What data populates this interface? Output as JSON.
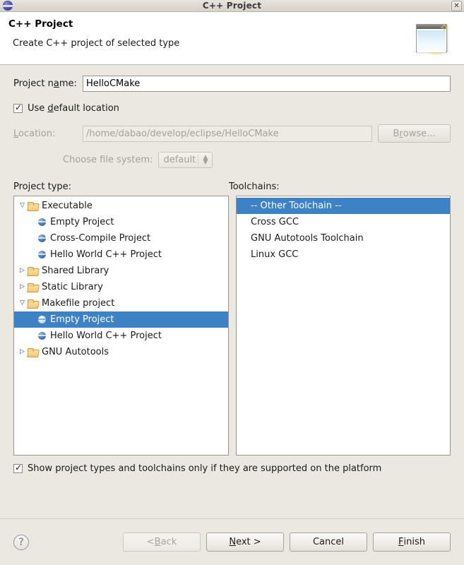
{
  "window": {
    "title": "C++ Project",
    "app_icon": "eclipse-sphere-icon",
    "close_label": "✕"
  },
  "banner": {
    "title": "C++ Project",
    "subtitle": "Create C++ project of selected type",
    "art_icon": "new-project-window-sparkle-icon"
  },
  "form": {
    "project_name_label_pre": "Project name:",
    "project_name_label_a": "Project n",
    "project_name_label_u": "a",
    "project_name_label_b": "me:",
    "project_name_value": "HelloCMake",
    "use_default_location_a": "Use ",
    "use_default_location_u": "d",
    "use_default_location_b": "efault location",
    "use_default_location_checked": true,
    "location_label_a": "",
    "location_label_u": "L",
    "location_label_b": "ocation:",
    "location_value": "/home/dabao/develop/eclipse/HelloCMake",
    "location_enabled": false,
    "browse_label_a": "B",
    "browse_label_u": "r",
    "browse_label_b": "owse...",
    "browse_enabled": false,
    "choose_fs_label": "Choose file system:",
    "choose_fs_value": "default",
    "choose_fs_enabled": false
  },
  "project_type": {
    "label": "Project type:",
    "items": [
      {
        "label": "Executable",
        "icon": "folder-icon",
        "depth": 0,
        "twisty": "expanded",
        "selected": false
      },
      {
        "label": "Empty Project",
        "icon": "sphere-icon",
        "depth": 1,
        "twisty": "none",
        "selected": false
      },
      {
        "label": "Cross-Compile Project",
        "icon": "sphere-icon",
        "depth": 1,
        "twisty": "none",
        "selected": false
      },
      {
        "label": "Hello World C++ Project",
        "icon": "sphere-icon",
        "depth": 1,
        "twisty": "none",
        "selected": false
      },
      {
        "label": "Shared Library",
        "icon": "folder-icon",
        "depth": 0,
        "twisty": "collapsed",
        "selected": false
      },
      {
        "label": "Static Library",
        "icon": "folder-icon",
        "depth": 0,
        "twisty": "collapsed",
        "selected": false
      },
      {
        "label": "Makefile project",
        "icon": "folder-icon",
        "depth": 0,
        "twisty": "expanded",
        "selected": false
      },
      {
        "label": "Empty Project",
        "icon": "sphere-light-icon",
        "depth": 1,
        "twisty": "none",
        "selected": true
      },
      {
        "label": "Hello World C++ Project",
        "icon": "sphere-icon",
        "depth": 1,
        "twisty": "none",
        "selected": false
      },
      {
        "label": "GNU Autotools",
        "icon": "folder-icon",
        "depth": 0,
        "twisty": "collapsed",
        "selected": false
      }
    ]
  },
  "toolchains": {
    "label": "Toolchains:",
    "items": [
      {
        "label": "-- Other Toolchain --",
        "selected": true
      },
      {
        "label": "Cross GCC",
        "selected": false
      },
      {
        "label": "GNU Autotools Toolchain",
        "selected": false
      },
      {
        "label": "Linux GCC",
        "selected": false
      }
    ]
  },
  "show_supported": {
    "label": "Show project types and toolchains only if they are supported on the platform",
    "checked": true
  },
  "footer": {
    "help_label": "?",
    "buttons": [
      {
        "name": "back",
        "pre": "< ",
        "u": "B",
        "post": "ack",
        "enabled": false
      },
      {
        "name": "next",
        "pre": "",
        "u": "N",
        "post": "ext >",
        "enabled": true
      },
      {
        "name": "cancel",
        "pre": "Cancel",
        "u": "",
        "post": "",
        "enabled": true
      },
      {
        "name": "finish",
        "pre": "",
        "u": "F",
        "post": "inish",
        "enabled": true
      }
    ]
  },
  "colors": {
    "selection_blue": "#3d82c4",
    "body_bg": "#ebe8e1",
    "banner_bg": "#ffffff"
  }
}
